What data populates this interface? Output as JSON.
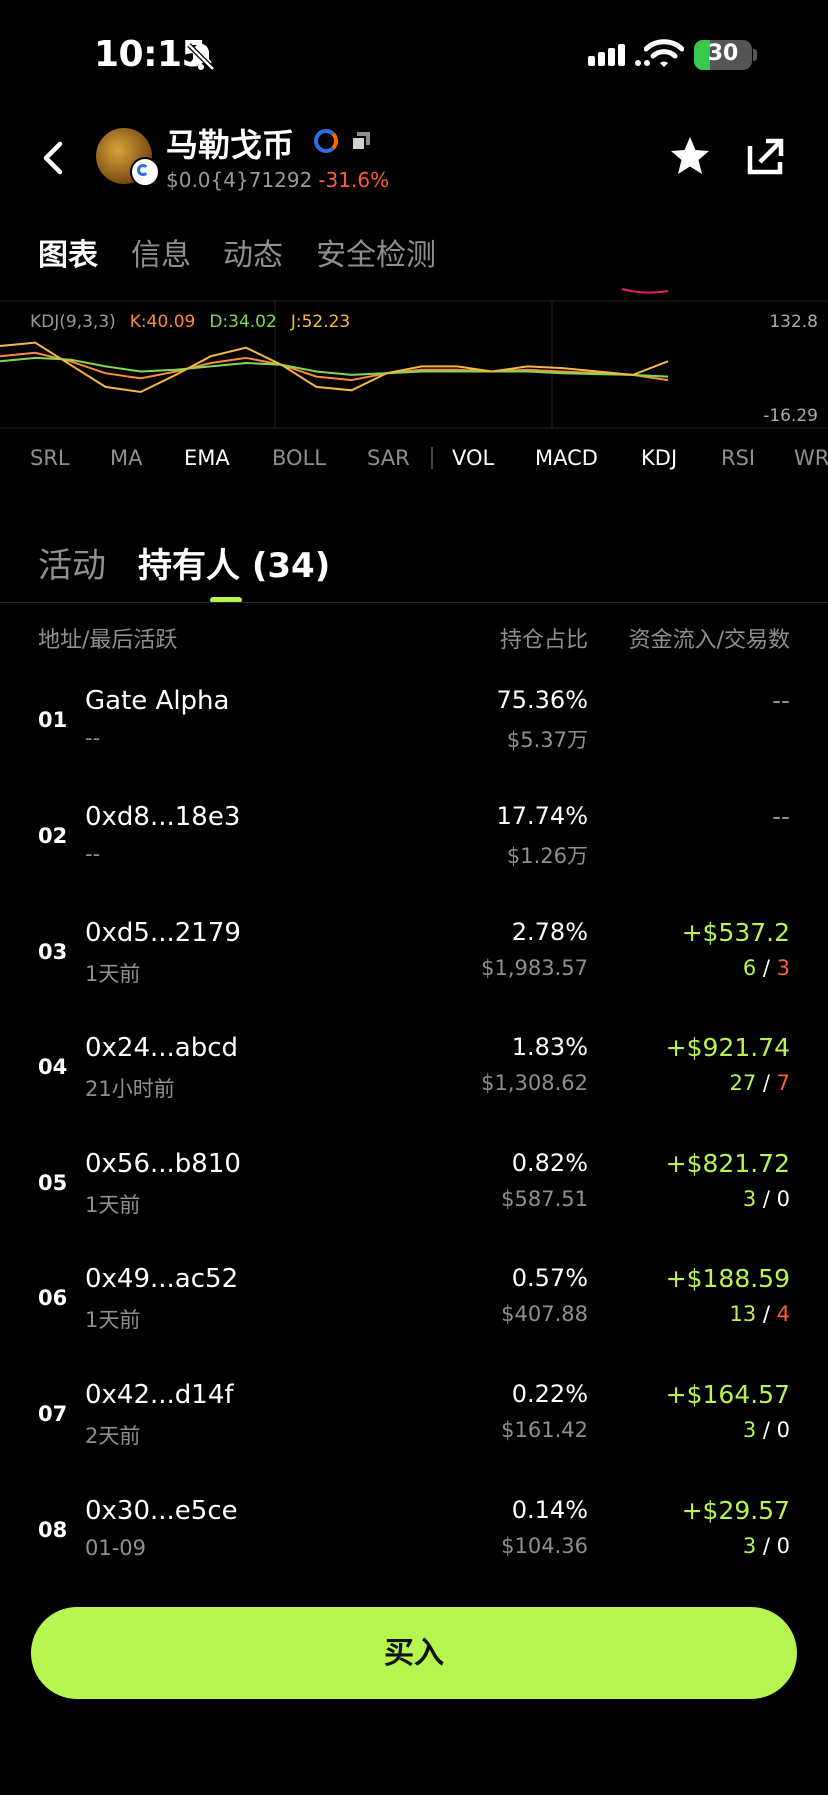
{
  "status_bar": {
    "time": "10:15",
    "battery": "30"
  },
  "header": {
    "coin_name": "马勒戈币",
    "price": "$0.0{4}71292",
    "change": "-31.6%"
  },
  "tabs": [
    "图表",
    "信息",
    "动态",
    "安全检测"
  ],
  "chart": {
    "indicator_name": "KDJ(9,3,3)",
    "k": "K:40.09",
    "d": "D:34.02",
    "j": "J:52.23",
    "axis_top": "132.8",
    "axis_bottom": "-16.29"
  },
  "chart_data": {
    "type": "line",
    "series": [
      {
        "name": "K",
        "values": [
          68,
          72,
          62,
          48,
          42,
          50,
          60,
          66,
          58,
          44,
          40,
          48,
          52,
          52,
          50,
          52,
          50,
          48,
          46,
          40
        ]
      },
      {
        "name": "D",
        "values": [
          62,
          66,
          64,
          56,
          50,
          52,
          56,
          60,
          58,
          50,
          46,
          48,
          50,
          50,
          50,
          50,
          48,
          47,
          46,
          44
        ]
      },
      {
        "name": "J",
        "values": [
          80,
          84,
          58,
          32,
          26,
          46,
          68,
          78,
          58,
          32,
          28,
          48,
          56,
          56,
          50,
          56,
          54,
          50,
          46,
          62
        ]
      }
    ],
    "ylim": [
      -16.29,
      132.8
    ]
  },
  "indicators": [
    "SRL",
    "MA",
    "EMA",
    "BOLL",
    "SAR",
    "VOL",
    "MACD",
    "KDJ",
    "RSI",
    "WR"
  ],
  "holders_tabs": {
    "activity": "活动",
    "holders": "持有人 (34)"
  },
  "table_header": {
    "address": "地址/最后活跃",
    "share": "持仓占比",
    "flow": "资金流入/交易数"
  },
  "rows": [
    {
      "rank": "01",
      "address": "Gate Alpha",
      "last": "--",
      "pct": "75.36%",
      "usd": "$5.37万",
      "flow": "--",
      "buys": "",
      "sells": "",
      "sep": ""
    },
    {
      "rank": "02",
      "address": "0xd8...18e3",
      "last": "--",
      "pct": "17.74%",
      "usd": "$1.26万",
      "flow": "--",
      "buys": "",
      "sells": "",
      "sep": ""
    },
    {
      "rank": "03",
      "address": "0xd5...2179",
      "last": "1天前",
      "pct": "2.78%",
      "usd": "$1,983.57",
      "flow": "+$537.2",
      "buys": "6",
      "sells": "3",
      "sep": " / "
    },
    {
      "rank": "04",
      "address": "0x24...abcd",
      "last": "21小时前",
      "pct": "1.83%",
      "usd": "$1,308.62",
      "flow": "+$921.74",
      "buys": "27",
      "sells": "7",
      "sep": " / "
    },
    {
      "rank": "05",
      "address": "0x56...b810",
      "last": "1天前",
      "pct": "0.82%",
      "usd": "$587.51",
      "flow": "+$821.72",
      "buys": "3",
      "sells": "0",
      "sep": " / "
    },
    {
      "rank": "06",
      "address": "0x49...ac52",
      "last": "1天前",
      "pct": "0.57%",
      "usd": "$407.88",
      "flow": "+$188.59",
      "buys": "13",
      "sells": "4",
      "sep": " / "
    },
    {
      "rank": "07",
      "address": "0x42...d14f",
      "last": "2天前",
      "pct": "0.22%",
      "usd": "$161.42",
      "flow": "+$164.57",
      "buys": "3",
      "sells": "0",
      "sep": " / "
    },
    {
      "rank": "08",
      "address": "0x30...e5ce",
      "last": "01-09",
      "pct": "0.14%",
      "usd": "$104.36",
      "flow": "+$29.57",
      "buys": "3",
      "sells": "0",
      "sep": " / "
    }
  ],
  "buy_label": "买入",
  "colors": {
    "accent": "#b6f550",
    "negative": "#ff5b3a",
    "k": "#ff8a3c",
    "d": "#7ed957",
    "j": "#f4b942"
  }
}
